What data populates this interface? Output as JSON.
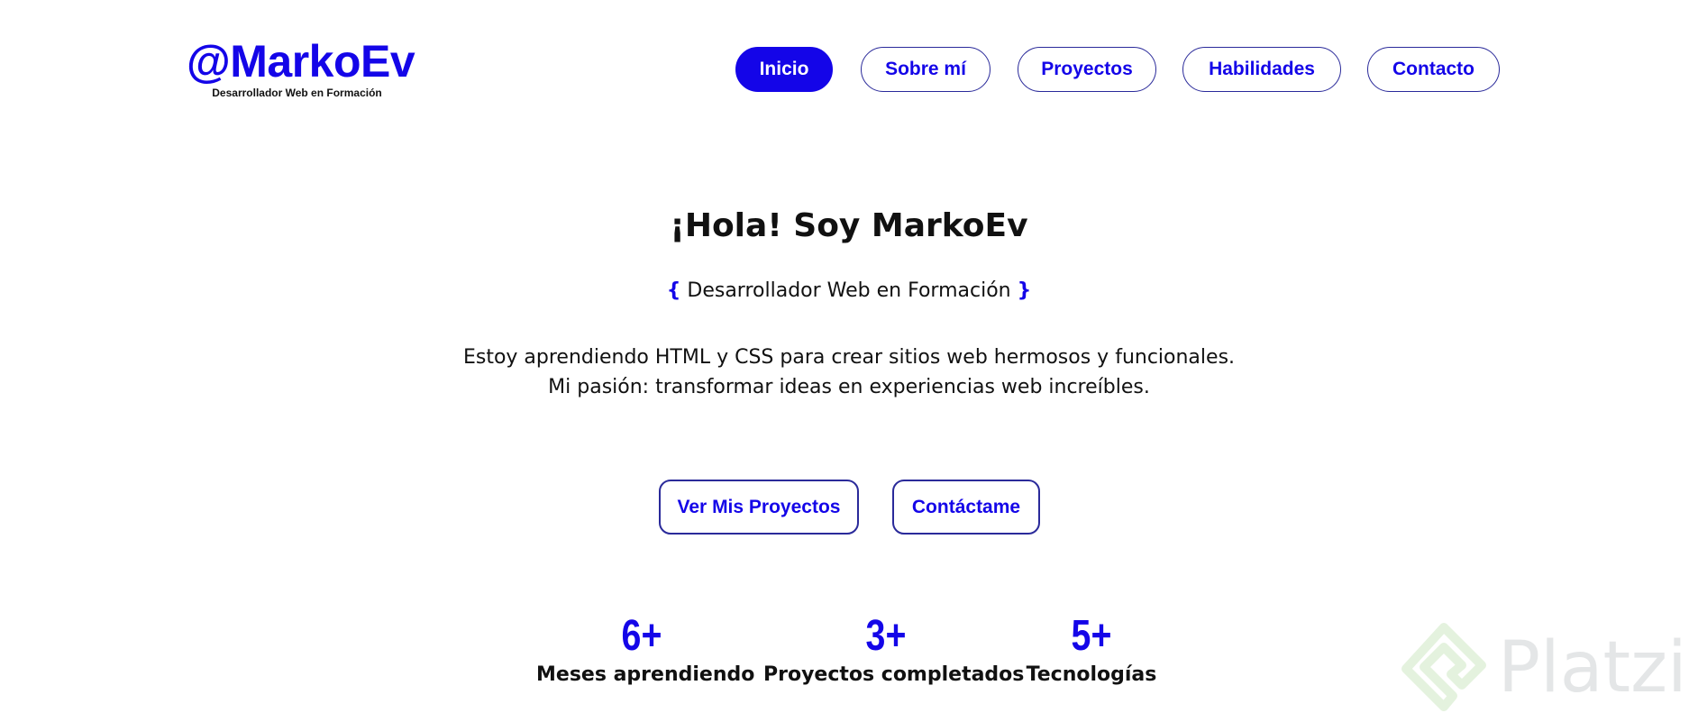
{
  "header": {
    "logo_title": "@MarkoEv",
    "logo_subtitle": "Desarrollador Web en Formación"
  },
  "nav": {
    "items": [
      {
        "label": "Inicio",
        "active": true
      },
      {
        "label": "Sobre mí",
        "active": false
      },
      {
        "label": "Proyectos",
        "active": false
      },
      {
        "label": "Habilidades",
        "active": false
      },
      {
        "label": "Contacto",
        "active": false
      }
    ]
  },
  "hero": {
    "title": "¡Hola! Soy MarkoEv",
    "subtitle_open": "{",
    "subtitle": "Desarrollador Web en Formación",
    "subtitle_close": "}",
    "description_line1": "Estoy aprendiendo HTML y CSS para crear sitios web hermosos y funcionales.",
    "description_line2": "Mi pasión: transformar ideas en experiencias web increíbles."
  },
  "cta": {
    "projects_label": "Ver Mis Proyectos",
    "contact_label": "Contáctame"
  },
  "stats": [
    {
      "number": "6+",
      "label": "Meses aprendiendo"
    },
    {
      "number": "3+",
      "label": "Proyectos completados"
    },
    {
      "number": "5+",
      "label": "Tecnologías"
    }
  ],
  "watermark": {
    "text": "Platzi",
    "icon": "platzi-logo-icon"
  },
  "colors": {
    "accent": "#1405e8",
    "text": "#111111",
    "background": "#ffffff"
  }
}
